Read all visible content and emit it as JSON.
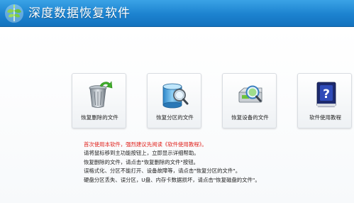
{
  "app": {
    "title": "深度数据恢复软件"
  },
  "tiles": [
    {
      "label": "恢复删除的文件",
      "icon": "recycle-bin-restore-icon"
    },
    {
      "label": "恢复分区的文件",
      "icon": "disk-partition-magnifier-icon"
    },
    {
      "label": "恢复设备的文件",
      "icon": "device-magnifier-icon"
    },
    {
      "label": "软件使用教程",
      "icon": "help-book-icon"
    }
  ],
  "tips": [
    "首次使用本软件，强烈建议先阅读《软件使用教程》。",
    "请将鼠标移到主功能按钮上，立即显示详细帮助。",
    "恢复删除的文件，请点击\"恢复删除的文件\"按钮。",
    "误格式化、分区不能打开、设备故障等，请点击\"恢复分区的文件\"。",
    "硬盘分区丢失、误分区，U盘、内存卡数据损坏，请点击\"恢复磁盘的文件\"。"
  ],
  "colors": {
    "titlebar": "#1c82cf",
    "warning_text": "#e0201a",
    "body_text": "#222222"
  }
}
